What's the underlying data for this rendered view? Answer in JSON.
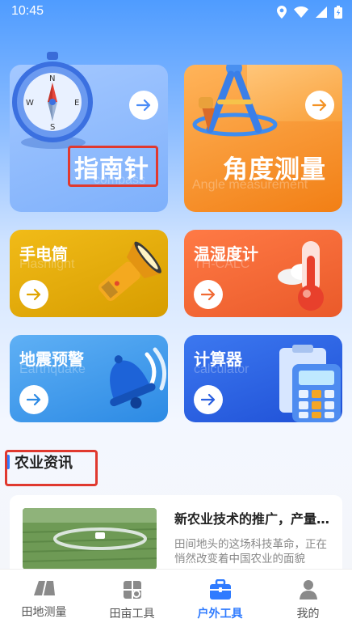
{
  "status_bar": {
    "time": "10:45"
  },
  "tools": {
    "compass": {
      "title": "指南针",
      "subtitle": "compass"
    },
    "angle": {
      "title": "角度测量",
      "subtitle": "Angle measurement"
    },
    "flashlight": {
      "title": "手电筒",
      "subtitle": "Flashlight"
    },
    "hygrometer": {
      "title": "温湿度计",
      "subtitle": "TH-CALC"
    },
    "earthquake": {
      "title": "地震预警",
      "subtitle": "Earthquake"
    },
    "calculator": {
      "title": "计算器",
      "subtitle": "calculator"
    }
  },
  "news": {
    "section_title": "农业资讯",
    "item": {
      "title": "新农业技术的推广，产量提升",
      "desc": "田间地头的这场科技革命，正在悄然改变着中国农业的面貌"
    }
  },
  "tabbar": {
    "items": [
      {
        "label": "田地测量",
        "icon": "field-measure-icon"
      },
      {
        "label": "田亩工具",
        "icon": "field-tools-icon"
      },
      {
        "label": "户外工具",
        "icon": "outdoor-toolbox-icon",
        "active": true
      },
      {
        "label": "我的",
        "icon": "profile-icon"
      }
    ]
  },
  "colors": {
    "accent": "#2F7BFF",
    "highlight": "#E0392F"
  }
}
